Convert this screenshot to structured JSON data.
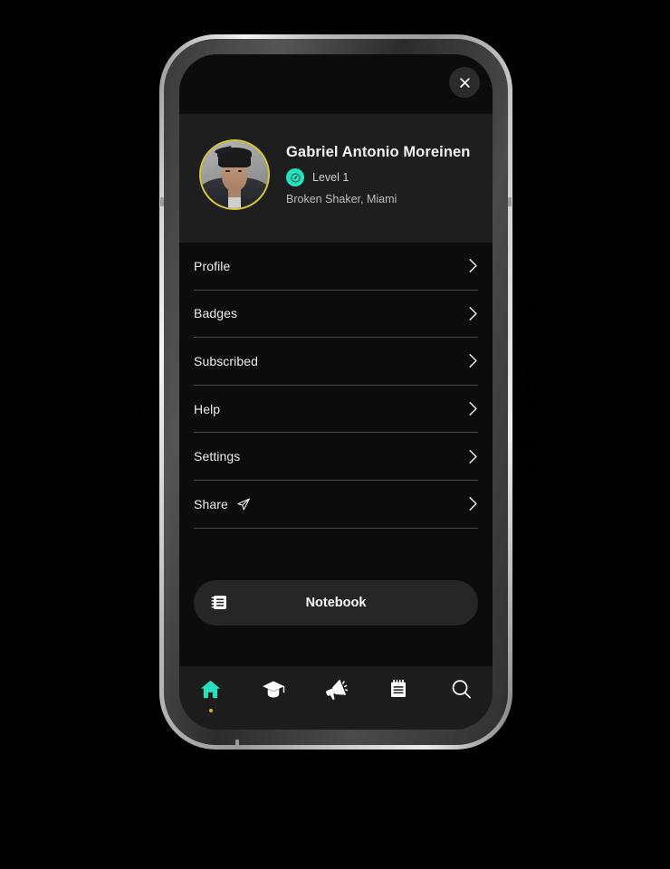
{
  "device": {
    "name": "smartphone-mockup"
  },
  "header": {
    "close_icon": "close-icon"
  },
  "profile": {
    "avatar_alt": "user-avatar-photo",
    "name": "Gabriel Antonio Moreinen",
    "level_badge_icon": "level-badge-icon",
    "level": "Level 1",
    "venue": "Broken Shaker, Miami",
    "ring_color": "#d8c531",
    "badge_color": "#29dfbe"
  },
  "menu": {
    "items": [
      {
        "label": "Profile",
        "icon": null,
        "chevron": "chevron-right-icon"
      },
      {
        "label": "Badges",
        "icon": null,
        "chevron": "chevron-right-icon"
      },
      {
        "label": "Subscribed",
        "icon": null,
        "chevron": "chevron-right-icon"
      },
      {
        "label": "Help",
        "icon": null,
        "chevron": "chevron-right-icon"
      },
      {
        "label": "Settings",
        "icon": null,
        "chevron": "chevron-right-icon"
      },
      {
        "label": "Share",
        "icon": "send-icon",
        "chevron": "chevron-right-icon"
      }
    ]
  },
  "notebook_button": {
    "label": "Notebook",
    "icon": "notebook-icon"
  },
  "bottom_nav": {
    "items": [
      {
        "name": "home",
        "icon": "home-icon",
        "active": true,
        "has_dot": true
      },
      {
        "name": "learn",
        "icon": "graduation-cap-icon",
        "active": false,
        "has_dot": false
      },
      {
        "name": "announcements",
        "icon": "megaphone-icon",
        "active": false,
        "has_dot": false
      },
      {
        "name": "notebook",
        "icon": "notebook-icon",
        "active": false,
        "has_dot": false
      },
      {
        "name": "search",
        "icon": "search-icon",
        "active": false,
        "has_dot": false
      }
    ],
    "active_color": "#29dfbe",
    "inactive_color": "#ffffff",
    "dot_color": "#d8b22a"
  }
}
